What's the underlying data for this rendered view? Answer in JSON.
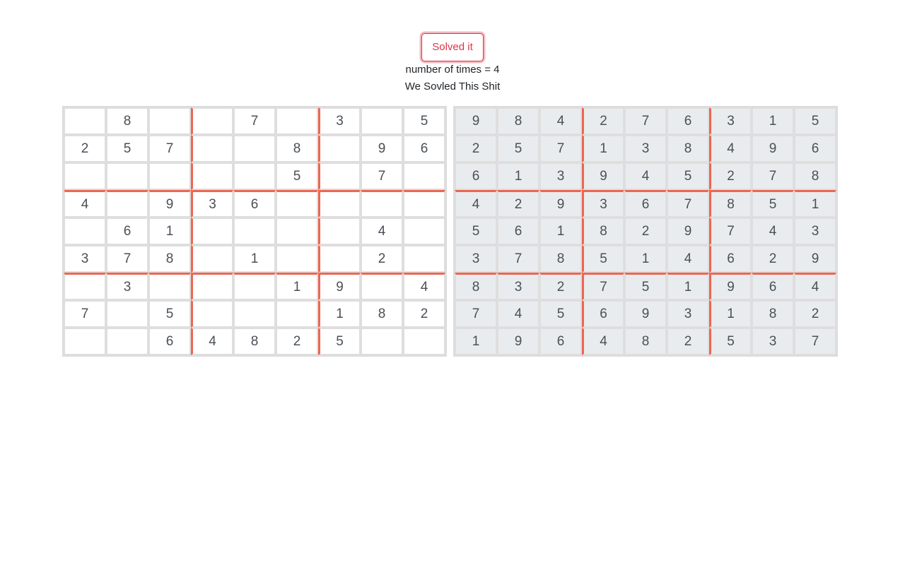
{
  "solve_button": {
    "label": "Solved it"
  },
  "status": {
    "times_line": "number of times = 4",
    "message": "We Sovled This Shit"
  },
  "colors": {
    "accent": "#dc3545",
    "block_divider": "#ed6651",
    "solved_cell_bg": "#e9ecef"
  },
  "puzzle": [
    [
      "",
      "8",
      "",
      "",
      "7",
      "",
      "3",
      "",
      "5"
    ],
    [
      "2",
      "5",
      "7",
      "",
      "",
      "8",
      "",
      "9",
      "6"
    ],
    [
      "",
      "",
      "",
      "",
      "",
      "5",
      "",
      "7",
      ""
    ],
    [
      "4",
      "",
      "9",
      "3",
      "6",
      "",
      "",
      "",
      ""
    ],
    [
      "",
      "6",
      "1",
      "",
      "",
      "",
      "",
      "4",
      ""
    ],
    [
      "3",
      "7",
      "8",
      "",
      "1",
      "",
      "",
      "2",
      ""
    ],
    [
      "",
      "3",
      "",
      "",
      "",
      "1",
      "9",
      "",
      "4"
    ],
    [
      "7",
      "",
      "5",
      "",
      "",
      "",
      "1",
      "8",
      "2"
    ],
    [
      "",
      "",
      "6",
      "4",
      "8",
      "2",
      "5",
      "",
      ""
    ]
  ],
  "solution": [
    [
      "9",
      "8",
      "4",
      "2",
      "7",
      "6",
      "3",
      "1",
      "5"
    ],
    [
      "2",
      "5",
      "7",
      "1",
      "3",
      "8",
      "4",
      "9",
      "6"
    ],
    [
      "6",
      "1",
      "3",
      "9",
      "4",
      "5",
      "2",
      "7",
      "8"
    ],
    [
      "4",
      "2",
      "9",
      "3",
      "6",
      "7",
      "8",
      "5",
      "1"
    ],
    [
      "5",
      "6",
      "1",
      "8",
      "2",
      "9",
      "7",
      "4",
      "3"
    ],
    [
      "3",
      "7",
      "8",
      "5",
      "1",
      "4",
      "6",
      "2",
      "9"
    ],
    [
      "8",
      "3",
      "2",
      "7",
      "5",
      "1",
      "9",
      "6",
      "4"
    ],
    [
      "7",
      "4",
      "5",
      "6",
      "9",
      "3",
      "1",
      "8",
      "2"
    ],
    [
      "1",
      "9",
      "6",
      "4",
      "8",
      "2",
      "5",
      "3",
      "7"
    ]
  ]
}
